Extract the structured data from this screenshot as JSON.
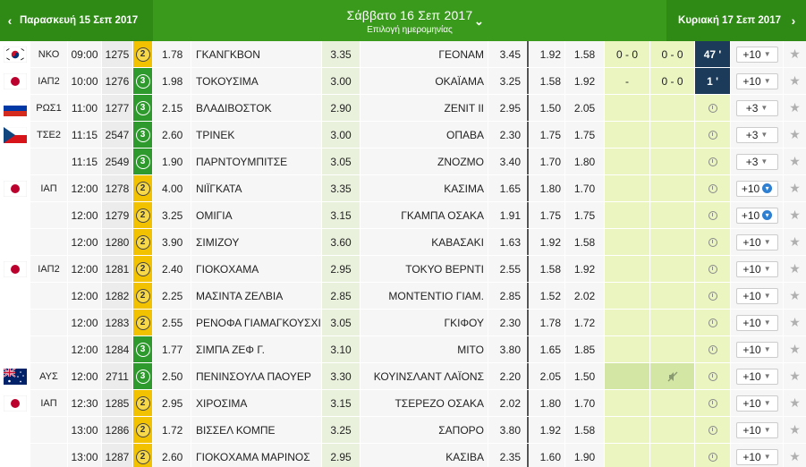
{
  "header": {
    "prev_day": "Παρασκευή 15 Σεπ 2017",
    "current_day": "Σάββατο 16 Σεπ 2017",
    "subtitle": "Επιλογή ημερομηνίας",
    "next_day": "Κυριακή 17 Σεπ 2017",
    "prev_arrow": "‹",
    "next_arrow": "›",
    "chevron": "⌄"
  },
  "rows": [
    {
      "flag": "south-korea",
      "league": "ΝΚΟ",
      "time": "09:00",
      "code": "1275",
      "min": "2",
      "o1": "1.78",
      "home": "ΓΚΑΝΓΚΒΟΝ",
      "ox": "3.35",
      "away": "ΓΕΟΝΑΜ",
      "o2": "3.45",
      "under": "1.92",
      "over": "1.58",
      "ht": "0 - 0",
      "ft": "0 - 0",
      "live": "47 '",
      "more": "+10",
      "more_type": "chevron"
    },
    {
      "flag": "japan",
      "league": "ΙΑΠ2",
      "time": "10:00",
      "code": "1276",
      "min": "3",
      "o1": "1.98",
      "home": "ΤΟΚΟΥΣΙΜΑ",
      "ox": "3.00",
      "away": "ΟΚΑΪΑΜΑ",
      "o2": "3.25",
      "under": "1.58",
      "over": "1.92",
      "ht": "-",
      "ft": "0 - 0",
      "live": "1 '",
      "more": "+10",
      "more_type": "chevron"
    },
    {
      "flag": "russia",
      "league": "ΡΩΣ1",
      "time": "11:00",
      "code": "1277",
      "min": "3",
      "o1": "2.15",
      "home": "ΒΛΑΔΙΒΟΣΤΟΚ",
      "ox": "2.90",
      "away": "ΖΕΝΙΤ ΙΙ",
      "o2": "2.95",
      "under": "1.50",
      "over": "2.05",
      "ht": "",
      "ft": "",
      "live": "",
      "more": "+3",
      "more_type": "chevron"
    },
    {
      "flag": "czech",
      "league": "ΤΣΕ2",
      "time": "11:15",
      "code": "2547",
      "min": "3",
      "o1": "2.60",
      "home": "ΤΡΙΝΕΚ",
      "ox": "3.00",
      "away": "ΟΠΑΒΑ",
      "o2": "2.30",
      "under": "1.75",
      "over": "1.75",
      "ht": "",
      "ft": "",
      "live": "",
      "more": "+3",
      "more_type": "chevron"
    },
    {
      "flag": "",
      "league": "",
      "time": "11:15",
      "code": "2549",
      "min": "3",
      "o1": "1.90",
      "home": "ΠΑΡΝΤΟΥΜΠΙΤΣΕ",
      "ox": "3.05",
      "away": "ΖΝΟΖΜΟ",
      "o2": "3.40",
      "under": "1.70",
      "over": "1.80",
      "ht": "",
      "ft": "",
      "live": "",
      "more": "+3",
      "more_type": "chevron"
    },
    {
      "flag": "japan",
      "league": "ΙΑΠ",
      "time": "12:00",
      "code": "1278",
      "min": "2",
      "o1": "4.00",
      "home": "ΝΙΪΓΚΑΤΑ",
      "ox": "3.35",
      "away": "ΚΑΣΙΜΑ",
      "o2": "1.65",
      "under": "1.80",
      "over": "1.70",
      "ht": "",
      "ft": "",
      "live": "",
      "more": "+10",
      "more_type": "plus"
    },
    {
      "flag": "",
      "league": "",
      "time": "12:00",
      "code": "1279",
      "min": "2",
      "o1": "3.25",
      "home": "ΟΜΙΓΙΑ",
      "ox": "3.15",
      "away": "ΓΚΑΜΠΑ ΟΣΑΚΑ",
      "o2": "1.91",
      "under": "1.75",
      "over": "1.75",
      "ht": "",
      "ft": "",
      "live": "",
      "more": "+10",
      "more_type": "plus"
    },
    {
      "flag": "",
      "league": "",
      "time": "12:00",
      "code": "1280",
      "min": "2",
      "o1": "3.90",
      "home": "ΣΙΜΙΖΟΥ",
      "ox": "3.60",
      "away": "ΚΑΒΑΣΑΚΙ",
      "o2": "1.63",
      "under": "1.92",
      "over": "1.58",
      "ht": "",
      "ft": "",
      "live": "",
      "more": "+10",
      "more_type": "chevron"
    },
    {
      "flag": "japan",
      "league": "ΙΑΠ2",
      "time": "12:00",
      "code": "1281",
      "min": "2",
      "o1": "2.40",
      "home": "ΓΙΟΚΟΧΑΜΑ",
      "ox": "2.95",
      "away": "ΤΟΚΥΟ ΒΕΡΝΤΙ",
      "o2": "2.55",
      "under": "1.58",
      "over": "1.92",
      "ht": "",
      "ft": "",
      "live": "",
      "more": "+10",
      "more_type": "chevron"
    },
    {
      "flag": "",
      "league": "",
      "time": "12:00",
      "code": "1282",
      "min": "2",
      "o1": "2.25",
      "home": "ΜΑΣΙΝΤΑ ΖΕΛΒΙΑ",
      "ox": "2.85",
      "away": "ΜΟΝΤΕΝΤΙΟ ΓΙΑΜ.",
      "o2": "2.85",
      "under": "1.52",
      "over": "2.02",
      "ht": "",
      "ft": "",
      "live": "",
      "more": "+10",
      "more_type": "chevron"
    },
    {
      "flag": "",
      "league": "",
      "time": "12:00",
      "code": "1283",
      "min": "2",
      "o1": "2.55",
      "home": "ΡΕΝΟΦΑ ΓΙΑΜΑΓΚΟΥΣΧΙ",
      "ox": "3.05",
      "away": "ΓΚΙΦΟΥ",
      "o2": "2.30",
      "under": "1.78",
      "over": "1.72",
      "ht": "",
      "ft": "",
      "live": "",
      "more": "+10",
      "more_type": "chevron"
    },
    {
      "flag": "",
      "league": "",
      "time": "12:00",
      "code": "1284",
      "min": "3",
      "o1": "1.77",
      "home": "ΣΙΜΠΑ ΖΕΦ Γ.",
      "ox": "3.10",
      "away": "ΜΙΤΟ",
      "o2": "3.80",
      "under": "1.65",
      "over": "1.85",
      "ht": "",
      "ft": "",
      "live": "",
      "more": "+10",
      "more_type": "chevron"
    },
    {
      "flag": "australia",
      "league": "ΑΥΣ",
      "time": "12:00",
      "code": "2711",
      "min": "3",
      "o1": "2.50",
      "home": "ΠΕΝΙΝΣΟΥΛΑ ΠΑΟΥΕΡ",
      "ox": "3.30",
      "away": "ΚΟΥΙΝΣΛΑΝΤ ΛΑΪΟΝΣ",
      "o2": "2.20",
      "under": "2.05",
      "over": "1.50",
      "ht": "",
      "ft": "mute",
      "live": "",
      "more": "+10",
      "more_type": "chevron"
    },
    {
      "flag": "japan",
      "league": "ΙΑΠ",
      "time": "12:30",
      "code": "1285",
      "min": "2",
      "o1": "2.95",
      "home": "ΧΙΡΟΣΙΜΑ",
      "ox": "3.15",
      "away": "ΤΣΕΡΕΖΟ ΟΣΑΚΑ",
      "o2": "2.02",
      "under": "1.80",
      "over": "1.70",
      "ht": "",
      "ft": "",
      "live": "",
      "more": "+10",
      "more_type": "chevron"
    },
    {
      "flag": "",
      "league": "",
      "time": "13:00",
      "code": "1286",
      "min": "2",
      "o1": "1.72",
      "home": "ΒΙΣΣΕΛ ΚΟΜΠΕ",
      "ox": "3.25",
      "away": "ΣΑΠΟΡΟ",
      "o2": "3.80",
      "under": "1.92",
      "over": "1.58",
      "ht": "",
      "ft": "",
      "live": "",
      "more": "+10",
      "more_type": "chevron"
    },
    {
      "flag": "",
      "league": "",
      "time": "13:00",
      "code": "1287",
      "min": "2",
      "o1": "2.60",
      "home": "ΓΙΟΚΟΧΑΜΑ ΜΑΡΙΝΟΣ",
      "ox": "2.95",
      "away": "ΚΑΣΙΒΑ",
      "o2": "2.35",
      "under": "1.60",
      "over": "1.90",
      "ht": "",
      "ft": "",
      "live": "",
      "more": "+10",
      "more_type": "chevron"
    }
  ],
  "icons": {
    "star": "star-icon",
    "clock": "clock-icon",
    "mute": "mute-icon"
  },
  "colors": {
    "header": "#3a9a1c",
    "header_dark": "#2e8a15",
    "min3": "#2e9a2e",
    "min2": "#f2c200",
    "live": "#1c3a5a",
    "more_plus": "#2e7fd2"
  }
}
